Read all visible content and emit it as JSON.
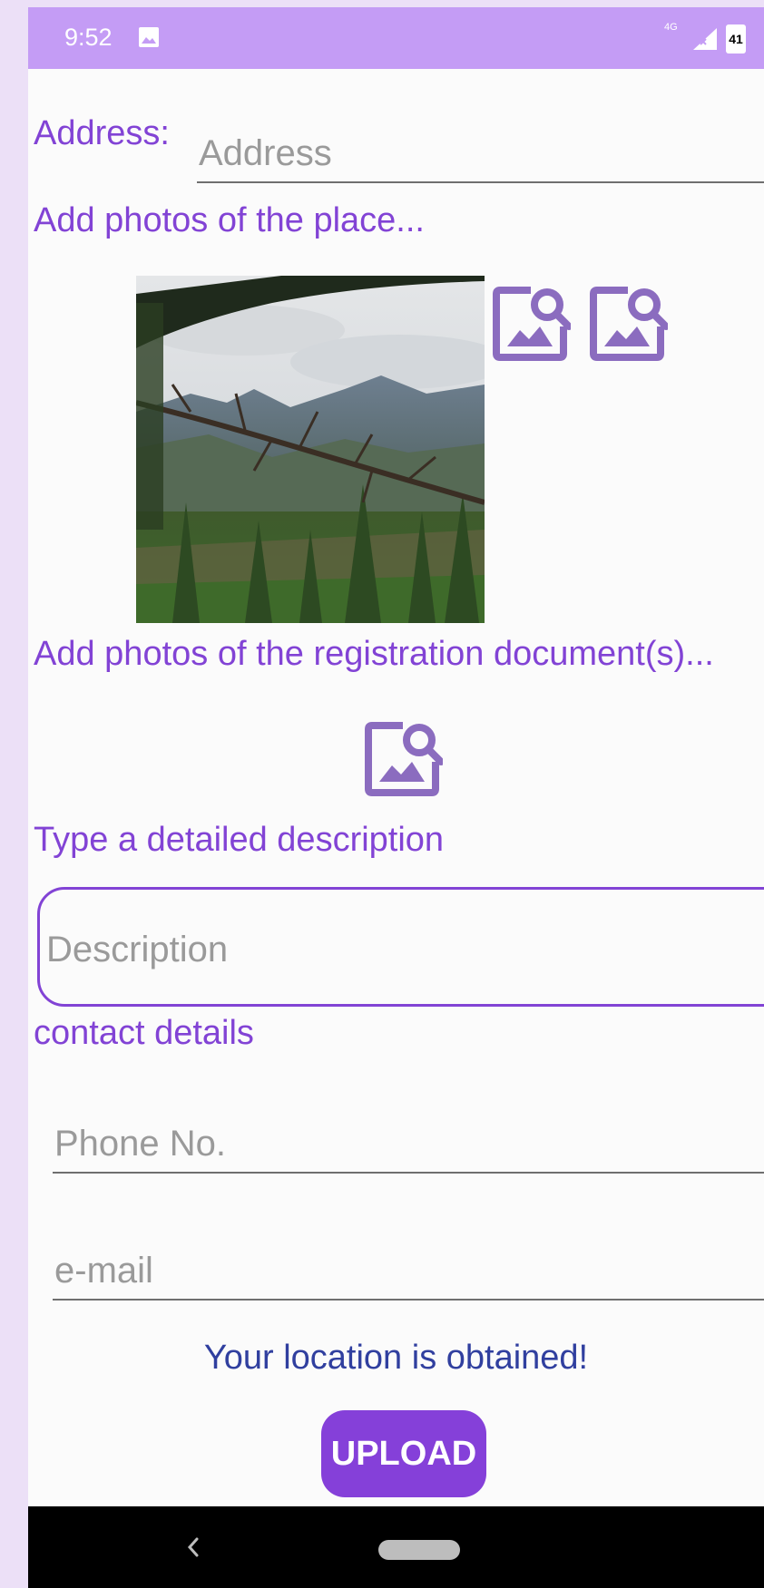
{
  "status_bar": {
    "time": "9:52",
    "network": "4G",
    "battery": "41",
    "background": "#c49cf5"
  },
  "form": {
    "address_label": "Address:",
    "address_placeholder": "Address",
    "place_photos_label": "Add photos of the place...",
    "registration_photos_label": "Add photos of the registration document(s)...",
    "description_label": "Type a detailed description",
    "description_placeholder": "Description",
    "contact_label": "contact details",
    "phone_placeholder": "Phone No.",
    "email_placeholder": "e-mail",
    "location_status": "Your location is obtained!",
    "upload_label": "UPLOAD"
  },
  "icons": {
    "image_search": "image-search-icon",
    "gallery": "image-icon",
    "back": "back-icon",
    "home": "home-pill"
  },
  "colors": {
    "accent": "#8243d5",
    "button": "#8540d9",
    "location_text": "#303f9f",
    "page_bg": "#ece0f7"
  }
}
